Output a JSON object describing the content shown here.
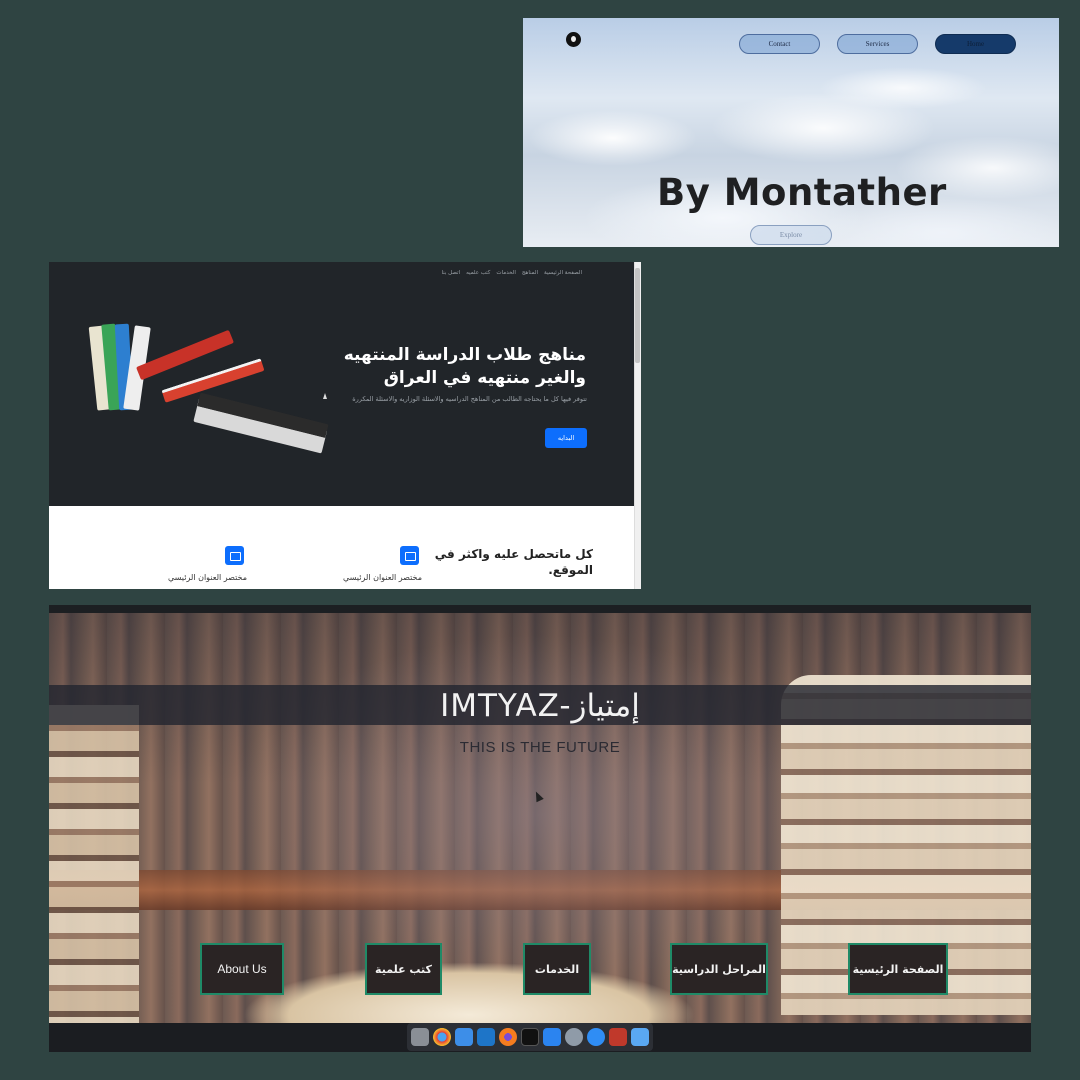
{
  "panel_clouds": {
    "nav": {
      "contact": "Contact",
      "services": "Services",
      "home": "Home"
    },
    "title": "By Montather",
    "explore": "Explore"
  },
  "panel_curricula": {
    "nav": [
      "الصفحة الرئيسية",
      "المناهج",
      "الخدمات",
      "كتب علميه",
      "اتصل بنا"
    ],
    "headline": "مناهج طلاب الدراسة المنتهيه والغير منتهيه في العراق",
    "lead": "تتوفر فيها كل ما يحتاجه الطالب من المناهج الدراسيه والاسئلة الوزاريه والاسئلة المكررة",
    "start_button": "البدايه",
    "features_title": "كل ماتحصل عليه واكثر في الموقع.",
    "feature_1": "مختصر العنوان الرئيسي",
    "feature_2": "مختصر العنوان الرئيسي"
  },
  "panel_imtyaz": {
    "brand": "IMTYAZ-إمتياز",
    "tagline": "THIS IS THE FUTURE",
    "nav": {
      "about": "About Us",
      "books": "كتب علمية",
      "services": "الخدمات",
      "stages": "المراحل الدراسية",
      "home": "الصفحة الرئيسية"
    }
  },
  "dock": {
    "apps": [
      "trash-icon",
      "chrome-icon",
      "finder-icon",
      "vscode-icon",
      "firefox-icon",
      "terminal-icon",
      "appstore-icon",
      "launchpad-icon",
      "safari-icon",
      "photobooth-icon",
      "files-icon"
    ]
  },
  "colors": {
    "background": "#2f4442",
    "hero_dark": "#212529",
    "primary_blue": "#0d6efd",
    "nav_border_green": "#1f8a67",
    "home_button_navy": "#153a6a"
  }
}
